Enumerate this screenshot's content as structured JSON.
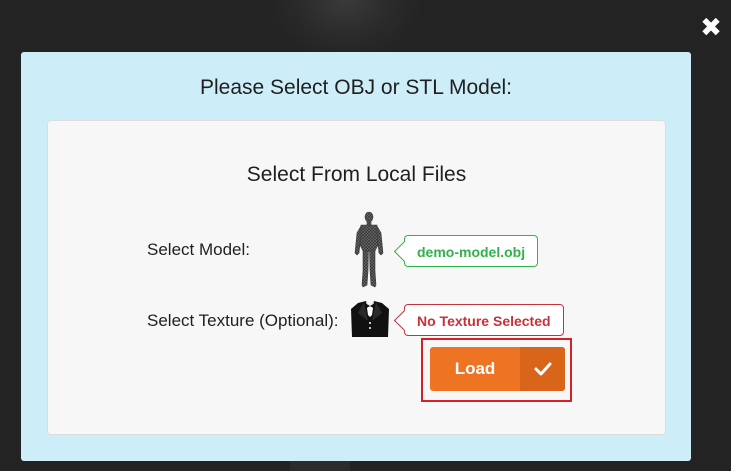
{
  "dialog": {
    "title": "Please Select OBJ or STL Model:",
    "close_icon": "close-icon"
  },
  "local_files": {
    "title": "Select From Local Files",
    "model": {
      "label": "Select Model:",
      "icon": "human-figure-icon",
      "status": "demo-model.obj",
      "status_color": "#2fb34a"
    },
    "texture": {
      "label": "Select Texture (Optional):",
      "icon": "tuxedo-icon",
      "status": "No Texture Selected",
      "status_color": "#c9313a"
    },
    "load_button": {
      "label": "Load",
      "icon": "checkmark-icon",
      "color": "#ee7322"
    }
  },
  "colors": {
    "dialog_background": "#cdeef8",
    "highlight_border": "#d62027"
  }
}
